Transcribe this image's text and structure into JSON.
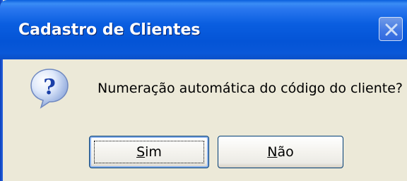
{
  "window": {
    "title": "Cadastro de Clientes"
  },
  "titlebar": {
    "close_icon": "close-icon"
  },
  "dialog": {
    "icon": "question-icon",
    "message": "Numeração automática do código do cliente?"
  },
  "buttons": {
    "yes": {
      "accel": "S",
      "rest": "im"
    },
    "no": {
      "accel": "N",
      "rest": "ão"
    }
  },
  "colors": {
    "titlebar": "#0a5ee0",
    "dialog_background": "#ece9d8",
    "button_border": "#003c74"
  }
}
